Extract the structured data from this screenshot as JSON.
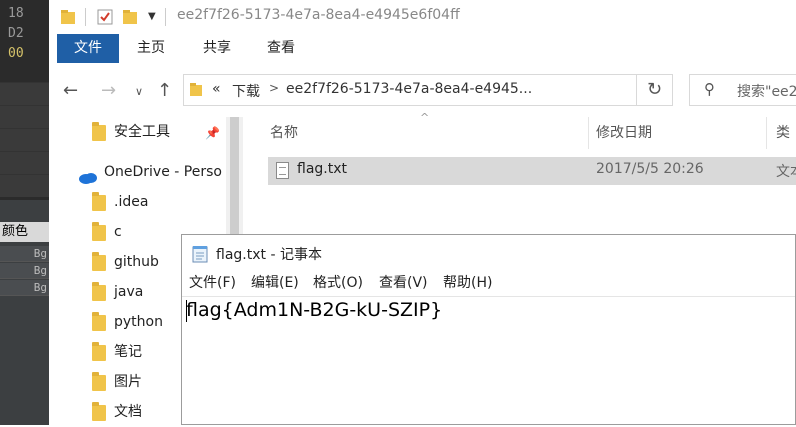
{
  "background_editor": {
    "line_numbers": [
      "18",
      "D2",
      "00"
    ],
    "panel_header": "颜色",
    "rows": [
      "Bg",
      "Bg",
      "Bg"
    ]
  },
  "window": {
    "title": "ee2f7f26-5173-4e7a-8ea4-e4945e6f04ff"
  },
  "ribbon": {
    "tabs": [
      "文件",
      "主页",
      "共享",
      "查看"
    ]
  },
  "address": {
    "overflow_glyph": "«",
    "segments": [
      "下载",
      "ee2f7f26-5173-4e7a-8ea4-e4945..."
    ],
    "search_placeholder": "搜索\"ee2"
  },
  "nav_pane": {
    "quick_access": [
      {
        "label": "安全工具",
        "pinned": true
      }
    ],
    "onedrive_label": "OneDrive - Perso",
    "folders": [
      ".idea",
      "c",
      "github",
      "java",
      "python",
      "笔记",
      "图片",
      "文档"
    ]
  },
  "file_list": {
    "columns": [
      "名称",
      "修改日期",
      "类型"
    ],
    "rows": [
      {
        "name": "flag.txt",
        "modified": "2017/5/5 20:26",
        "type": "文本"
      }
    ]
  },
  "notepad": {
    "title": "flag.txt - 记事本",
    "menu": [
      "文件(F)",
      "编辑(E)",
      "格式(O)",
      "查看(V)",
      "帮助(H)"
    ],
    "content": "flag{Adm1N-B2G-kU-SZIP}"
  },
  "colors": {
    "accent": "#1f5fa6",
    "selection": "#d9d9d9",
    "folder": "#f0c44a",
    "onedrive": "#1e73d8"
  }
}
